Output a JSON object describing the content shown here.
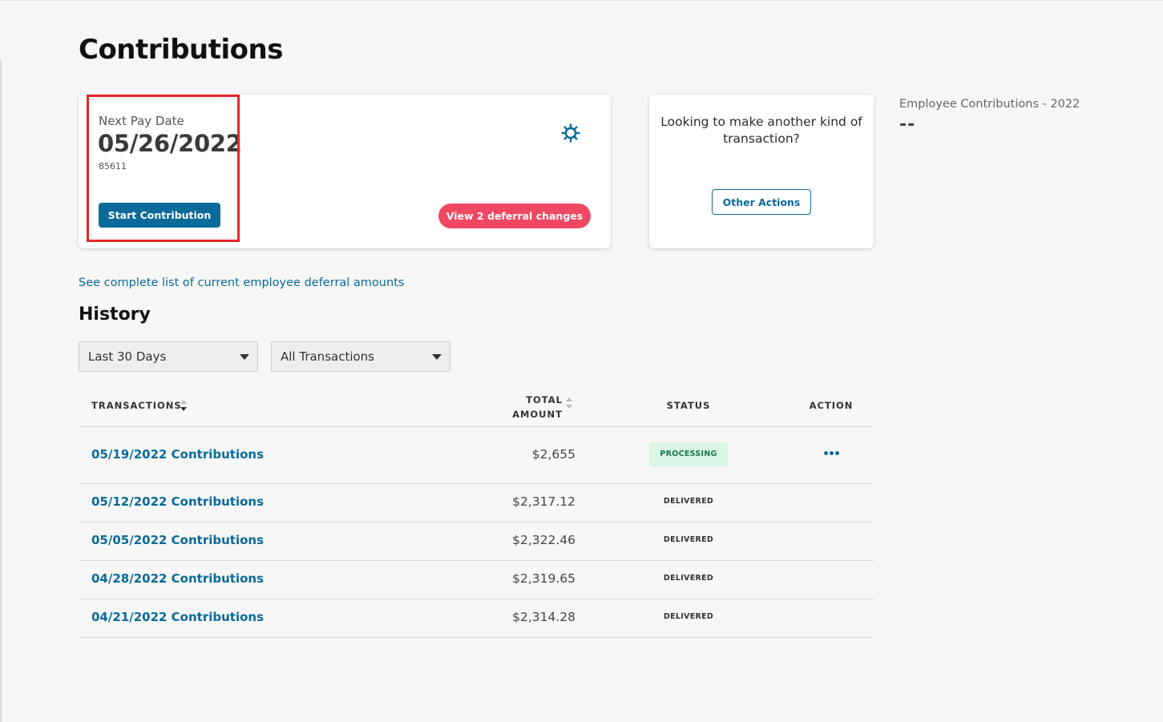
{
  "page": {
    "title": "Contributions"
  },
  "pay_card": {
    "label": "Next Pay Date",
    "date": "05/26/2022",
    "id": "85611",
    "start_button": "Start Contribution",
    "deferral_button": "View 2 deferral changes",
    "settings_icon": "gear-icon"
  },
  "other_card": {
    "question": "Looking to make another kind of transaction?",
    "button": "Other Actions"
  },
  "employee_contributions": {
    "label": "Employee Contributions - 2022",
    "value": "--"
  },
  "deferral_link": "See complete list of current employee deferral amounts",
  "history": {
    "title": "History",
    "filters": {
      "range": "Last 30 Days",
      "type": "All Transactions"
    },
    "columns": {
      "transactions": "TRANSACTIONS",
      "total_line1": "TOTAL",
      "total_line2": "AMOUNT",
      "status": "STATUS",
      "action": "ACTION"
    },
    "rows": [
      {
        "name": "05/19/2022 Contributions",
        "amount": "$2,655",
        "status": "PROCESSING"
      },
      {
        "name": "05/12/2022 Contributions",
        "amount": "$2,317.12",
        "status": "DELIVERED"
      },
      {
        "name": "05/05/2022 Contributions",
        "amount": "$2,322.46",
        "status": "DELIVERED"
      },
      {
        "name": "04/28/2022 Contributions",
        "amount": "$2,319.65",
        "status": "DELIVERED"
      },
      {
        "name": "04/21/2022 Contributions",
        "amount": "$2,314.28",
        "status": "DELIVERED"
      }
    ]
  },
  "colors": {
    "primary": "#0a6a99",
    "deferral": "#ef4862",
    "highlight": "#e8262b",
    "processing_bg": "#d8f5e6",
    "processing_text": "#197a4a"
  }
}
